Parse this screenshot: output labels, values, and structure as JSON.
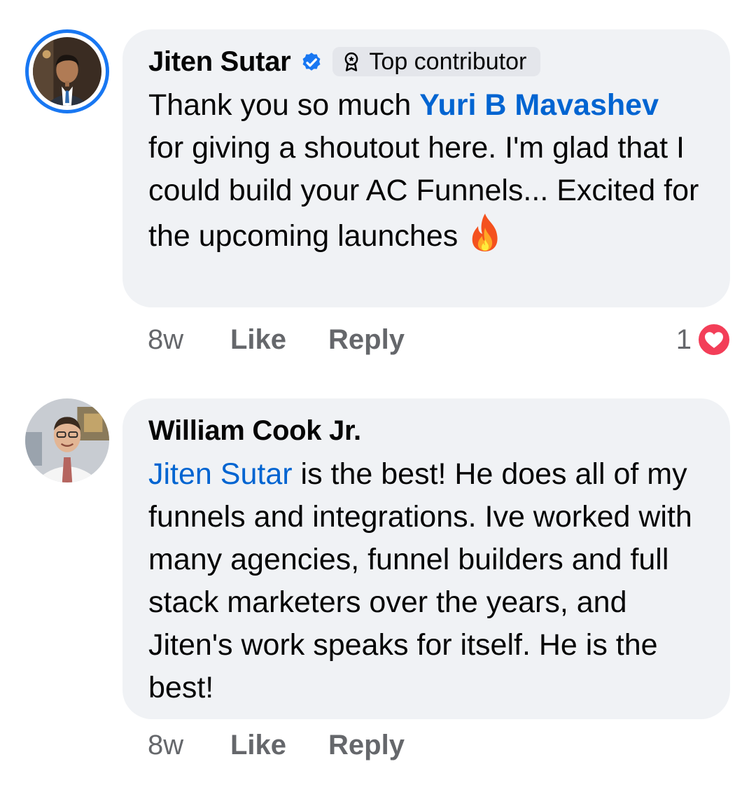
{
  "comments": [
    {
      "author": "Jiten Sutar",
      "verified": true,
      "badge": {
        "label": "Top contributor",
        "icon": "award-ribbon-icon"
      },
      "avatar_has_story_ring": true,
      "body_parts": {
        "before_mention": "Thank you so much ",
        "mention": "Yuri B Mavashev",
        "after_mention": " for giving a shoutout here. I'm glad that I could build your AC Funnels... Excited for the upcoming launches ",
        "emoji": "fire-emoji"
      },
      "time": "8w",
      "like_label": "Like",
      "reply_label": "Reply",
      "reaction_count": "1",
      "reaction_icon": "heart-reaction-icon"
    },
    {
      "author": "William Cook Jr.",
      "verified": false,
      "body_parts": {
        "mention": "Jiten Sutar",
        "after_mention": " is the best! He does all of my funnels and integrations. Ive worked with many agencies, funnel builders and full stack marketers over the years, and Jiten's work speaks for itself. He is the best!"
      },
      "time": "8w",
      "like_label": "Like",
      "reply_label": "Reply"
    }
  ],
  "colors": {
    "bubble": "#f0f2f5",
    "mention": "#0064d1",
    "ring": "#1877f2",
    "meta": "#65676b",
    "heart": "#f33e58"
  }
}
